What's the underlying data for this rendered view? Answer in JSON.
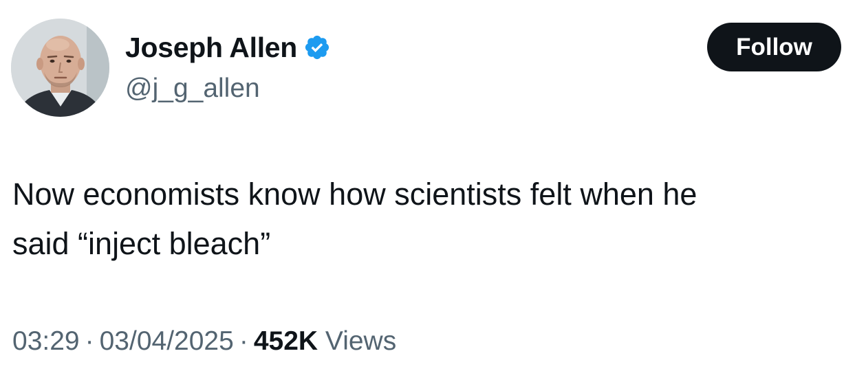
{
  "author": {
    "display_name": "Joseph Allen",
    "handle": "@j_g_allen",
    "verified": true,
    "verified_badge_color": "#1d9bf0"
  },
  "follow_button": {
    "label": "Follow",
    "background": "#0f1419",
    "text_color": "#ffffff"
  },
  "tweet": {
    "text_lines": [
      "Now economists know how scientists felt when he",
      "said “inject bleach”"
    ]
  },
  "meta": {
    "time": "03:29",
    "separator": "·",
    "date": "03/04/2025",
    "views_count": "452K",
    "views_label": "Views"
  },
  "icons": {
    "verified": "verified-badge-icon"
  }
}
